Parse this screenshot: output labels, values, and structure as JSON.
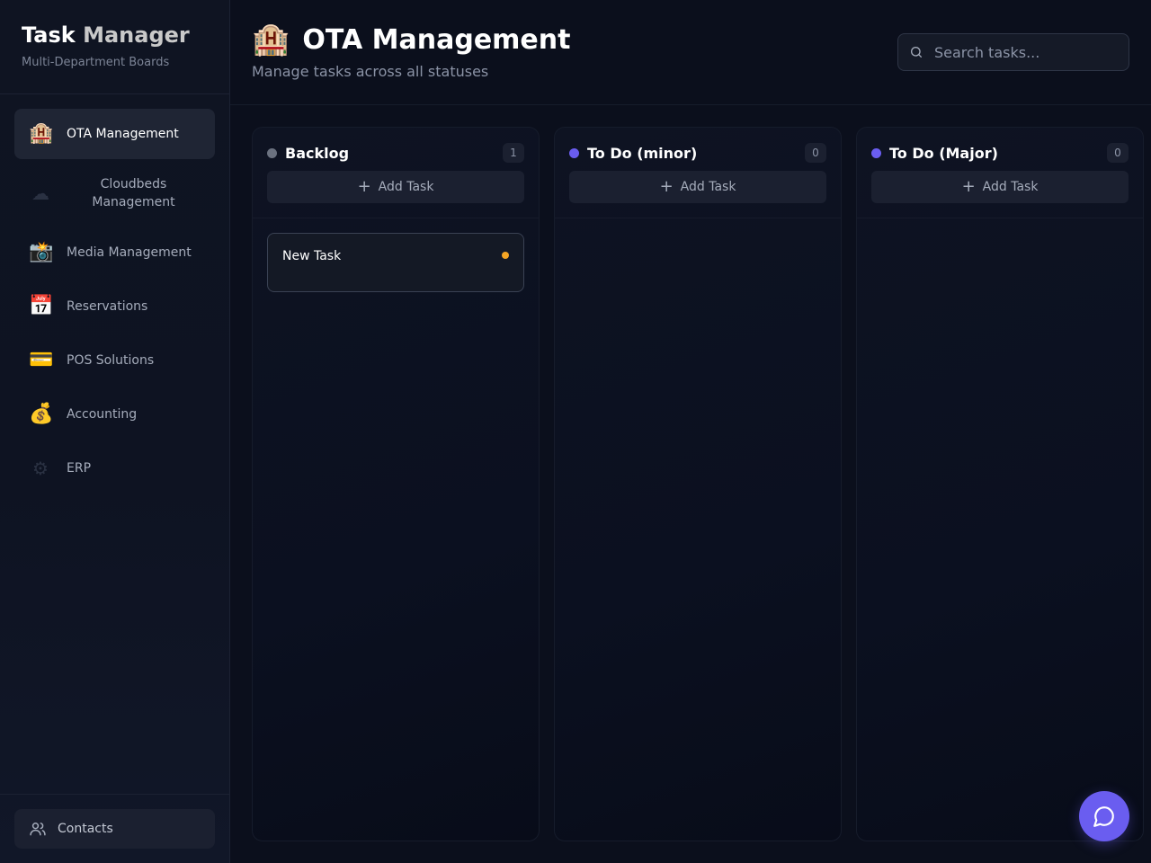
{
  "app": {
    "title_main": "Task",
    "title_accent": "Manager",
    "subtitle": "Multi-Department Boards"
  },
  "sidebar": {
    "items": [
      {
        "icon": "hotel-icon",
        "glyph": "🏨",
        "label": "OTA Management",
        "active": true
      },
      {
        "icon": "cloud-icon",
        "glyph": "☁",
        "label": "Cloudbeds Management",
        "active": false
      },
      {
        "icon": "camera-flash-icon",
        "glyph": "📸",
        "label": "Media Management",
        "active": false
      },
      {
        "icon": "calendar-icon",
        "glyph": "📅",
        "label": "Reservations",
        "active": false
      },
      {
        "icon": "credit-card-icon",
        "glyph": "💳",
        "label": "POS Solutions",
        "active": false
      },
      {
        "icon": "money-bag-icon",
        "glyph": "💰",
        "label": "Accounting",
        "active": false
      },
      {
        "icon": "gear-icon",
        "glyph": "⚙",
        "label": "ERP",
        "active": false
      }
    ],
    "footer": {
      "contacts_label": "Contacts"
    }
  },
  "header": {
    "title_icon": "🏨",
    "title": "OTA Management",
    "subtitle": "Manage tasks across all statuses",
    "search_placeholder": "Search tasks..."
  },
  "board": {
    "add_task_label": "Add Task",
    "columns": [
      {
        "title": "Backlog",
        "count": "1",
        "dot_color": "#6b7280",
        "tasks": [
          {
            "title": "New Task",
            "priority_color": "#f5a524"
          }
        ]
      },
      {
        "title": "To Do (minor)",
        "count": "0",
        "dot_color": "#6a5df0",
        "tasks": []
      },
      {
        "title": "To Do (Major)",
        "count": "0",
        "dot_color": "#6a5df0",
        "tasks": []
      }
    ]
  },
  "colors": {
    "accent": "#6a5df0",
    "background": "#0b0f1c",
    "priority_medium": "#f5a524"
  }
}
